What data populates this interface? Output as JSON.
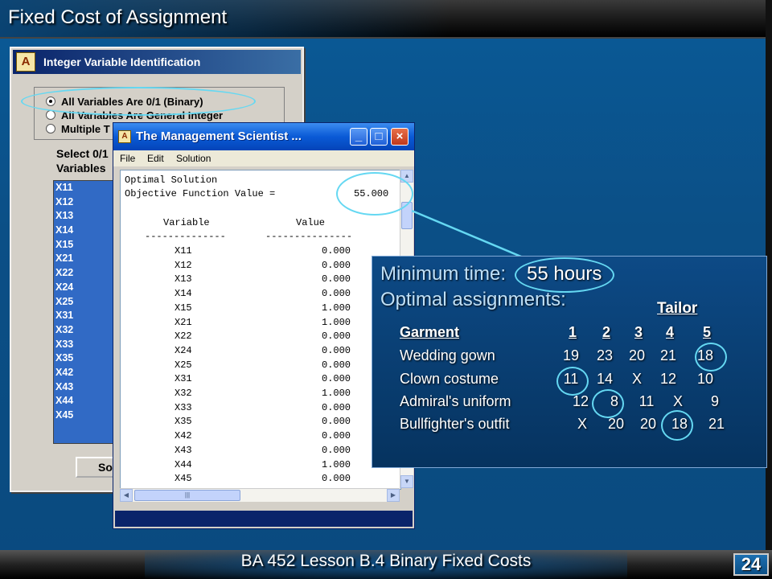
{
  "slide": {
    "title": "Fixed Cost of Assignment",
    "footer": "BA 452  Lesson B.4 Binary Fixed Costs",
    "page_number": "24"
  },
  "integer_dialog": {
    "logo_glyph": "A",
    "title": "Integer Variable Identification",
    "radio_options": [
      {
        "label": "All Variables Are 0/1 (Binary)",
        "checked": true
      },
      {
        "label": "All Variables Are General Integer",
        "checked": false
      },
      {
        "label": "Multiple T",
        "checked": false
      }
    ],
    "select_label_line1": "Select 0/1",
    "select_label_line2": "Variables",
    "variables": [
      "X11",
      "X12",
      "X13",
      "X14",
      "X15",
      "X21",
      "X22",
      "X24",
      "X25",
      "X31",
      "X32",
      "X33",
      "X35",
      "X42",
      "X43",
      "X44",
      "X45"
    ],
    "solve_label": "Sol"
  },
  "tms_window": {
    "title": "The Management Scientist ...",
    "menu": [
      "File",
      "Edit",
      "Solution"
    ],
    "output_header": "Optimal Solution",
    "objective_label": "Objective Function Value =",
    "objective_value": "55.000",
    "col_variable": "Variable",
    "col_value": "Value",
    "dash_variable": "--------------",
    "dash_value": "---------------",
    "rows": [
      {
        "var": "X11",
        "val": "0.000"
      },
      {
        "var": "X12",
        "val": "0.000"
      },
      {
        "var": "X13",
        "val": "0.000"
      },
      {
        "var": "X14",
        "val": "0.000"
      },
      {
        "var": "X15",
        "val": "1.000"
      },
      {
        "var": "X21",
        "val": "1.000"
      },
      {
        "var": "X22",
        "val": "0.000"
      },
      {
        "var": "X24",
        "val": "0.000"
      },
      {
        "var": "X25",
        "val": "0.000"
      },
      {
        "var": "X31",
        "val": "0.000"
      },
      {
        "var": "X32",
        "val": "1.000"
      },
      {
        "var": "X33",
        "val": "0.000"
      },
      {
        "var": "X35",
        "val": "0.000"
      },
      {
        "var": "X42",
        "val": "0.000"
      },
      {
        "var": "X43",
        "val": "0.000"
      },
      {
        "var": "X44",
        "val": "1.000"
      },
      {
        "var": "X45",
        "val": "0.000"
      }
    ]
  },
  "panel": {
    "line1": "Minimum time:",
    "hours": "55 hours",
    "line2": "Optimal assignments:",
    "tailor_header": "Tailor",
    "garment_header": "Garment",
    "tailor_numbers": [
      "1",
      "2",
      "3",
      "4",
      "5"
    ],
    "garments": [
      {
        "name": "Wedding gown",
        "values": [
          "19",
          "23",
          "20",
          "21",
          "18"
        ]
      },
      {
        "name": "Clown costume",
        "values": [
          "11",
          "14",
          "X",
          "12",
          "10"
        ]
      },
      {
        "name": "Admiral's uniform",
        "values": [
          "12",
          "8",
          "11",
          "X",
          "9"
        ]
      },
      {
        "name": "Bullfighter's outfit",
        "values": [
          "X",
          "20",
          "20",
          "18",
          "21"
        ]
      }
    ]
  },
  "colors": {
    "slide_blue": "#0b4f86",
    "highlight": "#65d8f2",
    "list_selection": "#316ac5"
  }
}
